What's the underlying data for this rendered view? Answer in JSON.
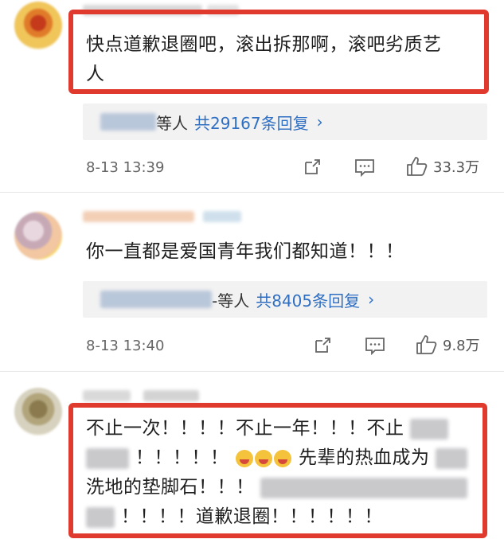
{
  "comments": [
    {
      "text_line1": "快点道歉退圈吧，滚出拆那啊，滚吧劣质艺",
      "text_line2": "人",
      "reply_suffix": "等人",
      "reply_count": "共29167条回复",
      "time": "8-13 13:39",
      "likes": "33.3万"
    },
    {
      "text_line1": "你一直都是爱国青年我们都知道！！！",
      "reply_suffix": "-等人",
      "reply_count": "共8405条回复",
      "time": "8-13 13:40",
      "likes": "9.8万"
    },
    {
      "line1": "不止一次！！！！不止一年！！！不止",
      "line2a": "！！！！！",
      "line2b": "先辈的热血成为",
      "line3": "洗地的垫脚石！！！",
      "line4": "！！！！道歉退圈！！！！！！"
    }
  ],
  "icons": {
    "share": "share-icon",
    "comment": "comment-icon",
    "like": "thumbs-up-icon",
    "chevron": "chevron-right-icon"
  },
  "colors": {
    "highlight": "#e03a2e",
    "link": "#2f6fc3"
  }
}
